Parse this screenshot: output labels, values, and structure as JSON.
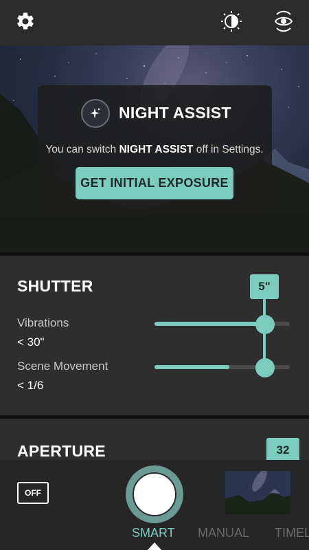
{
  "toolbar": {
    "settings_icon": "gear-icon",
    "exposure_icon": "exposure-compensation-icon",
    "view_icon": "eye-rotate-icon"
  },
  "night_assist": {
    "title": "NIGHT ASSIST",
    "message_pre": "You can switch ",
    "message_bold": "NIGHT ASSIST",
    "message_post": " off in Settings.",
    "button_label": "GET INITIAL EXPOSURE",
    "icon": "sparkle-icon"
  },
  "shutter": {
    "title": "SHUTTER",
    "value": "5\"",
    "vibrations": {
      "label": "Vibrations",
      "value": "< 30\"",
      "level": 0.8
    },
    "scene_movement": {
      "label": "Scene Movement",
      "value": "< 1/6",
      "level": 0.55
    }
  },
  "aperture": {
    "title": "APERTURE",
    "value": "32"
  },
  "bottom": {
    "flash_label": "OFF",
    "modes": [
      "SMART",
      "MANUAL",
      "TIMEL"
    ],
    "active_mode": "SMART"
  },
  "colors": {
    "accent": "#7ccbbf",
    "panel": "#2e2e2e",
    "background": "#1f1f1f"
  }
}
